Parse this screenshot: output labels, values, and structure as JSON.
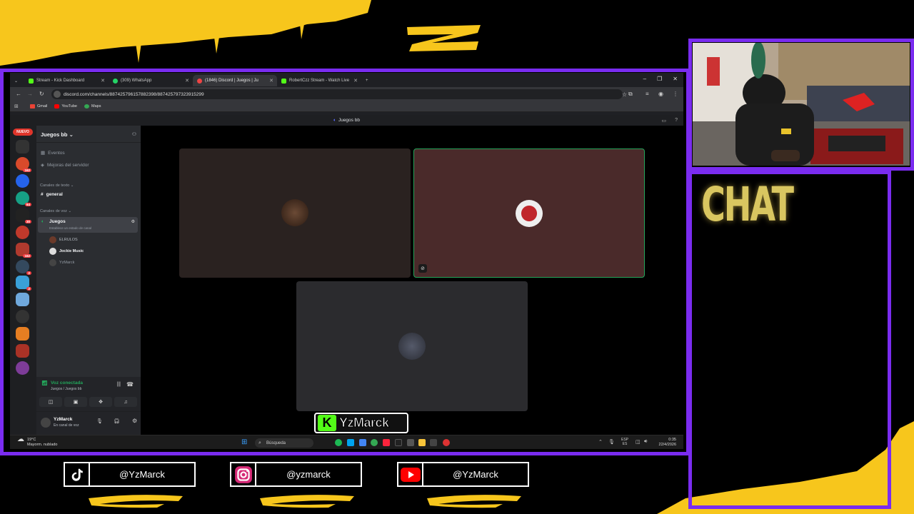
{
  "browser": {
    "tabs": [
      {
        "label": "Stream - Kick Dashboard",
        "color": "#53fc18"
      },
      {
        "label": "(309) WhatsApp",
        "color": "#25d366"
      },
      {
        "label": "(1846) Discord | Juegos | Ju",
        "color": "#5865f2"
      },
      {
        "label": "RobertCzz Stream - Watch Live",
        "color": "#53fc18"
      }
    ],
    "url": "discord.com/channels/887425796157882398/887425797323915299",
    "bookmarks": [
      "Gmail",
      "YouTube",
      "Maps"
    ]
  },
  "discord": {
    "window_title": "Juegos bb",
    "new_badge": "NUEVO",
    "guild_badges": [
      "162",
      "64",
      "30",
      "162",
      "2",
      "2"
    ],
    "server_name": "Juegos bb",
    "menu": [
      "Eventos",
      "Mejoras del servidor"
    ],
    "text_category": "Canales de texto",
    "text_channel": "general",
    "voice_category": "Canales de voz",
    "voice_channel": "Juegos",
    "voice_status": "Establece un estado de canal",
    "members": [
      "ELRULOS",
      "Jockie Music",
      "YzMarck"
    ],
    "voice_connected": "Voz conectada",
    "voice_location": "Juegos / Juegos bb",
    "user_name": "YzMarck",
    "user_status": "En canal de voz"
  },
  "taskbar": {
    "temperature": "19°C",
    "weather": "Mayorm. nublado",
    "search_placeholder": "Búsqueda",
    "lang": "ESP",
    "lang_sub": "ES",
    "time": "0:35",
    "date": "22/4/2026"
  },
  "overlay": {
    "chat_title": "CHAT",
    "streamer_tag": "YzMarck",
    "socials": [
      {
        "platform": "tiktok",
        "handle": "@YzMarck"
      },
      {
        "platform": "instagram",
        "handle": "@yzmarck"
      },
      {
        "platform": "youtube",
        "handle": "@YzMarck"
      }
    ]
  },
  "colors": {
    "frame_purple": "#7a2cf0",
    "paint_yellow": "#f7c61c",
    "kick_green": "#53fc18",
    "discord_green": "#23a55a"
  }
}
